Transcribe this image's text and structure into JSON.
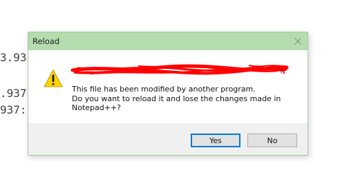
{
  "background": {
    "lines": [
      "3.93",
      ".937",
      "937:"
    ]
  },
  "dialog": {
    "title": "Reload",
    "close_icon": "close-icon",
    "warning_icon": "warning-triangle-icon",
    "redacted_note": "",
    "message_lines": [
      "This file has been modified by another program.",
      "Do you want to reload it and lose the changes made in",
      "Notepad++?"
    ],
    "buttons": {
      "yes_label": "Yes",
      "no_label": "No"
    }
  },
  "colors": {
    "titlebar": "#b4dcae",
    "border": "#9fcf98",
    "default_button_border": "#0078d7",
    "redaction": "#ff0000",
    "warning_fill": "#ffd200"
  }
}
